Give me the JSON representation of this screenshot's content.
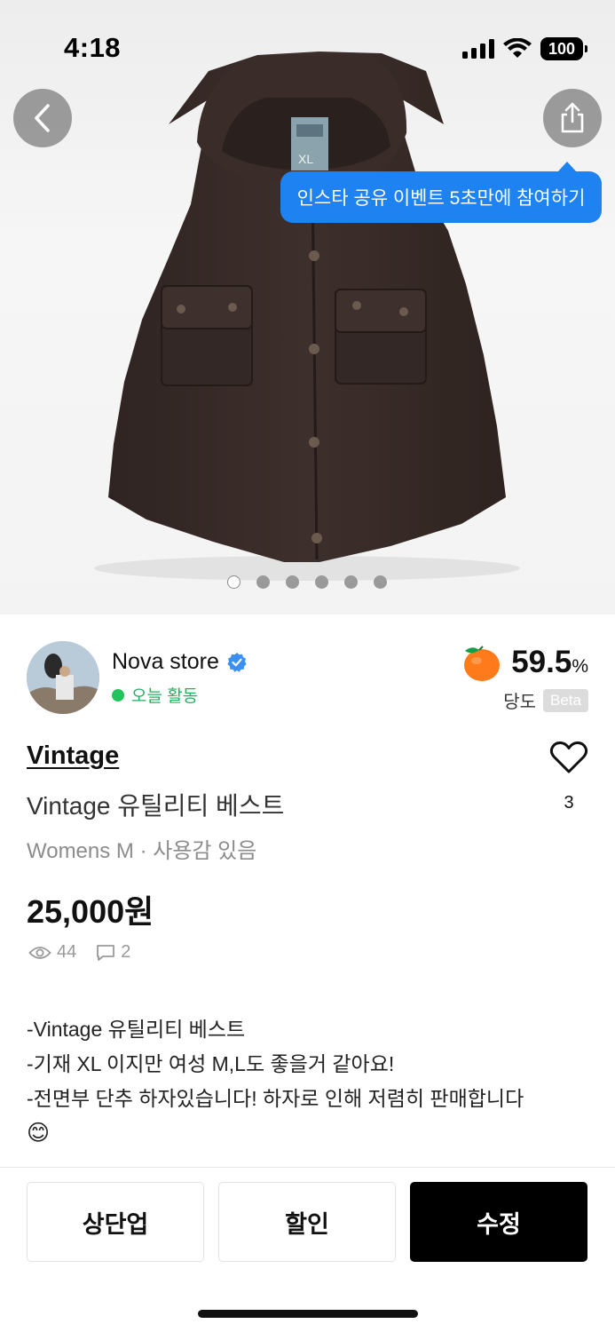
{
  "statusbar": {
    "time": "4:18",
    "battery": "100"
  },
  "hero": {
    "tooltip": "인스타 공유 이벤트 5초만에 참여하기",
    "photo_count": 6,
    "active_photo": 1,
    "tag_text": "XL"
  },
  "seller": {
    "name": "Nova store",
    "activity": "오늘 활동",
    "score_value": "59.5",
    "score_unit": "%",
    "score_label": "당도",
    "score_badge": "Beta"
  },
  "product": {
    "brand": "Vintage",
    "title": "Vintage 유틸리티 베스트",
    "meta": "Womens M · 사용감 있음",
    "price": "25,000원",
    "views": "44",
    "comments": "2",
    "likes": "3"
  },
  "description": {
    "line1": "-Vintage 유틸리티 베스트",
    "line2": "-기재 XL 이지만 여성 M,L도 좋을거 같아요!",
    "line3": "-전면부 단추 하자있습니다! 하자로 인해 저렴히 판매합니다",
    "emoji": "😊"
  },
  "actions": {
    "bump": "상단업",
    "discount": "할인",
    "edit": "수정"
  },
  "colors": {
    "accent_blue": "#1e83f0",
    "active_green": "#23c45e",
    "primary_black": "#000000"
  }
}
